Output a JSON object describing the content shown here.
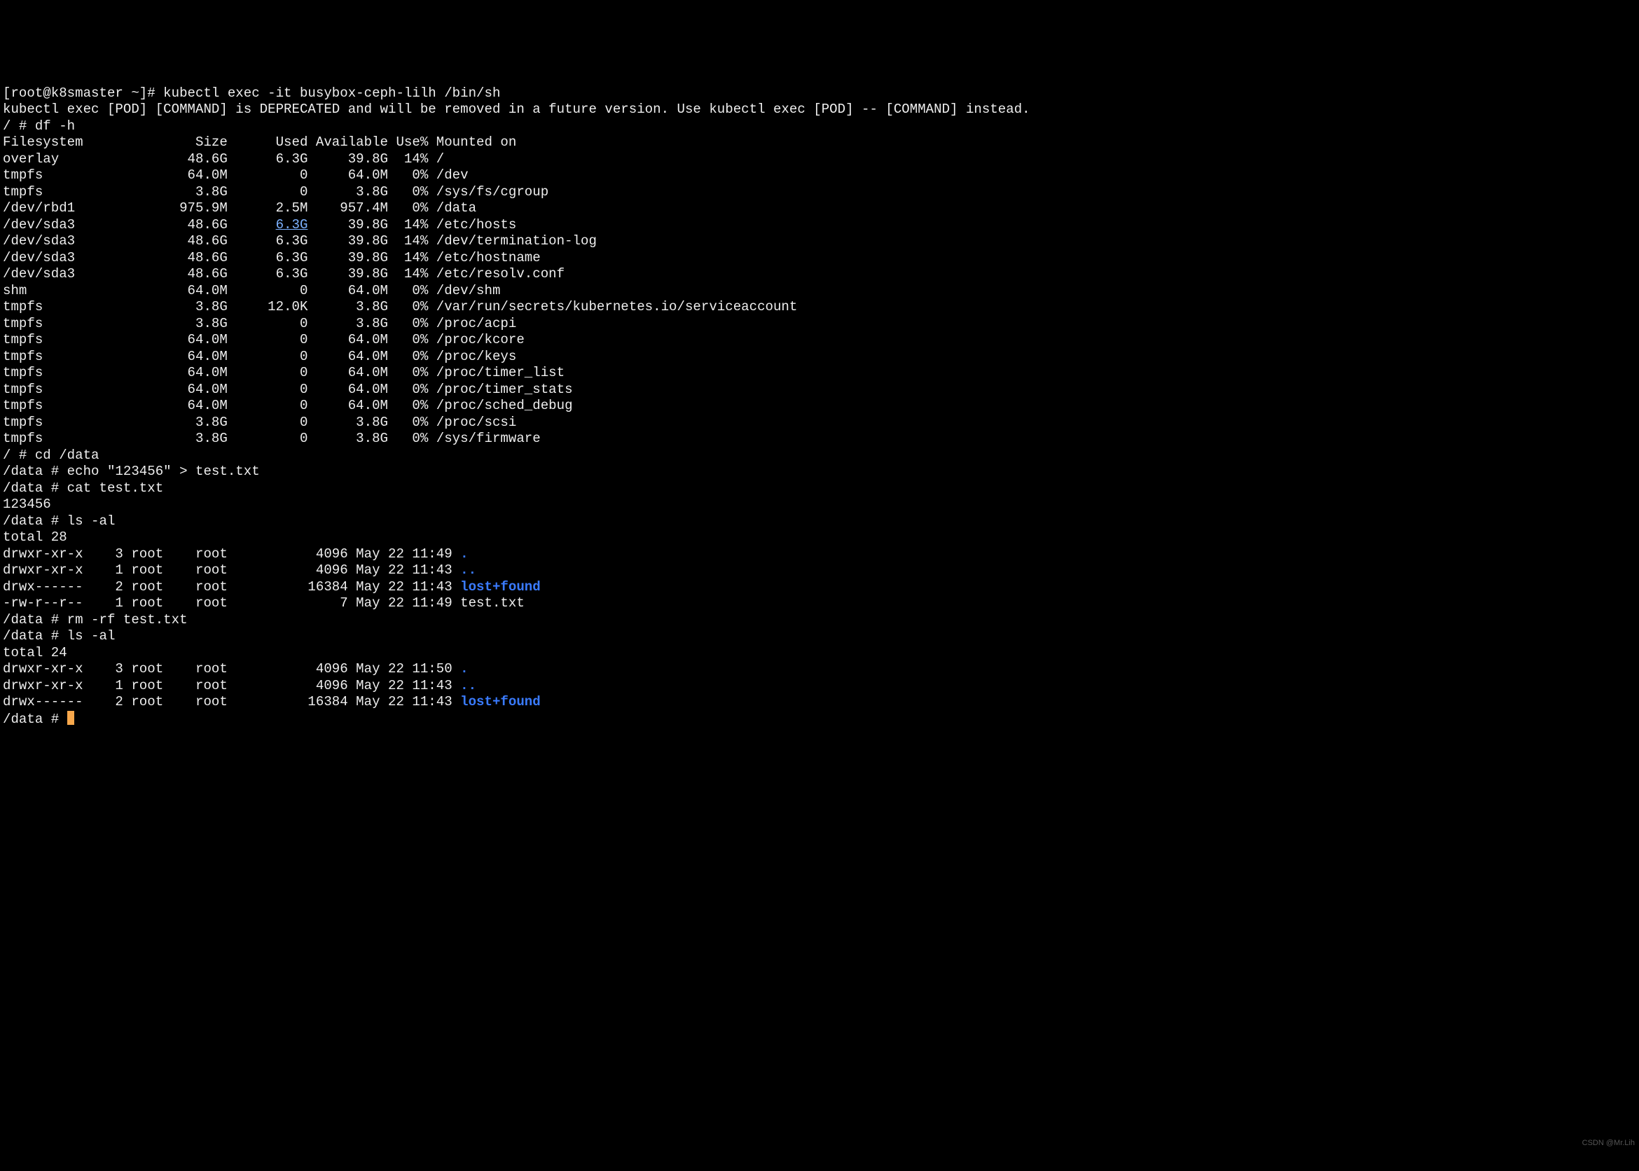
{
  "watermark": "CSDN @Mr.Lih",
  "prompt1": "[root@k8smaster ~]# kubectl exec -it busybox-ceph-lilh /bin/sh",
  "deprecated": "kubectl exec [POD] [COMMAND] is DEPRECATED and will be removed in a future version. Use kubectl exec [POD] -- [COMMAND] instead.",
  "cmd_df": "/ # df -h",
  "df_header": {
    "fs": "Filesystem",
    "size": "Size",
    "used": "Used",
    "avail": "Available",
    "usep": "Use%",
    "mnt": "Mounted on"
  },
  "df_rows": [
    {
      "fs": "overlay",
      "size": "48.6G",
      "used": "6.3G",
      "avail": "39.8G",
      "usep": "14%",
      "mnt": "/"
    },
    {
      "fs": "tmpfs",
      "size": "64.0M",
      "used": "0",
      "avail": "64.0M",
      "usep": "0%",
      "mnt": "/dev"
    },
    {
      "fs": "tmpfs",
      "size": "3.8G",
      "used": "0",
      "avail": "3.8G",
      "usep": "0%",
      "mnt": "/sys/fs/cgroup"
    },
    {
      "fs": "/dev/rbd1",
      "size": "975.9M",
      "used": "2.5M",
      "avail": "957.4M",
      "usep": "0%",
      "mnt": "/data"
    },
    {
      "fs": "/dev/sda3",
      "size": "48.6G",
      "used": "6.3G",
      "avail": "39.8G",
      "usep": "14%",
      "mnt": "/etc/hosts",
      "hl": true
    },
    {
      "fs": "/dev/sda3",
      "size": "48.6G",
      "used": "6.3G",
      "avail": "39.8G",
      "usep": "14%",
      "mnt": "/dev/termination-log"
    },
    {
      "fs": "/dev/sda3",
      "size": "48.6G",
      "used": "6.3G",
      "avail": "39.8G",
      "usep": "14%",
      "mnt": "/etc/hostname"
    },
    {
      "fs": "/dev/sda3",
      "size": "48.6G",
      "used": "6.3G",
      "avail": "39.8G",
      "usep": "14%",
      "mnt": "/etc/resolv.conf"
    },
    {
      "fs": "shm",
      "size": "64.0M",
      "used": "0",
      "avail": "64.0M",
      "usep": "0%",
      "mnt": "/dev/shm"
    },
    {
      "fs": "tmpfs",
      "size": "3.8G",
      "used": "12.0K",
      "avail": "3.8G",
      "usep": "0%",
      "mnt": "/var/run/secrets/kubernetes.io/serviceaccount"
    },
    {
      "fs": "tmpfs",
      "size": "3.8G",
      "used": "0",
      "avail": "3.8G",
      "usep": "0%",
      "mnt": "/proc/acpi"
    },
    {
      "fs": "tmpfs",
      "size": "64.0M",
      "used": "0",
      "avail": "64.0M",
      "usep": "0%",
      "mnt": "/proc/kcore"
    },
    {
      "fs": "tmpfs",
      "size": "64.0M",
      "used": "0",
      "avail": "64.0M",
      "usep": "0%",
      "mnt": "/proc/keys"
    },
    {
      "fs": "tmpfs",
      "size": "64.0M",
      "used": "0",
      "avail": "64.0M",
      "usep": "0%",
      "mnt": "/proc/timer_list"
    },
    {
      "fs": "tmpfs",
      "size": "64.0M",
      "used": "0",
      "avail": "64.0M",
      "usep": "0%",
      "mnt": "/proc/timer_stats"
    },
    {
      "fs": "tmpfs",
      "size": "64.0M",
      "used": "0",
      "avail": "64.0M",
      "usep": "0%",
      "mnt": "/proc/sched_debug"
    },
    {
      "fs": "tmpfs",
      "size": "3.8G",
      "used": "0",
      "avail": "3.8G",
      "usep": "0%",
      "mnt": "/proc/scsi"
    },
    {
      "fs": "tmpfs",
      "size": "3.8G",
      "used": "0",
      "avail": "3.8G",
      "usep": "0%",
      "mnt": "/sys/firmware"
    }
  ],
  "cmd_cd": "/ # cd /data",
  "cmd_echo": "/data # echo \"123456\" > test.txt",
  "cmd_cat": "/data # cat test.txt",
  "cat_out": "123456",
  "cmd_ls1": "/data # ls -al",
  "ls1_total": "total 28",
  "ls1_rows": [
    {
      "perm": "drwxr-xr-x",
      "ln": "3",
      "u": "root",
      "g": "root",
      "sz": "4096",
      "dt": "May 22 11:49",
      "name": ".",
      "dir": true
    },
    {
      "perm": "drwxr-xr-x",
      "ln": "1",
      "u": "root",
      "g": "root",
      "sz": "4096",
      "dt": "May 22 11:43",
      "name": "..",
      "dir": true
    },
    {
      "perm": "drwx------",
      "ln": "2",
      "u": "root",
      "g": "root",
      "sz": "16384",
      "dt": "May 22 11:43",
      "name": "lost+found",
      "dir": true
    },
    {
      "perm": "-rw-r--r--",
      "ln": "1",
      "u": "root",
      "g": "root",
      "sz": "7",
      "dt": "May 22 11:49",
      "name": "test.txt"
    }
  ],
  "cmd_rm": "/data # rm -rf test.txt",
  "cmd_ls2": "/data # ls -al",
  "ls2_total": "total 24",
  "ls2_rows": [
    {
      "perm": "drwxr-xr-x",
      "ln": "3",
      "u": "root",
      "g": "root",
      "sz": "4096",
      "dt": "May 22 11:50",
      "name": ".",
      "dir": true
    },
    {
      "perm": "drwxr-xr-x",
      "ln": "1",
      "u": "root",
      "g": "root",
      "sz": "4096",
      "dt": "May 22 11:43",
      "name": "..",
      "dir": true
    },
    {
      "perm": "drwx------",
      "ln": "2",
      "u": "root",
      "g": "root",
      "sz": "16384",
      "dt": "May 22 11:43",
      "name": "lost+found",
      "dir": true
    }
  ],
  "prompt_end": "/data # "
}
